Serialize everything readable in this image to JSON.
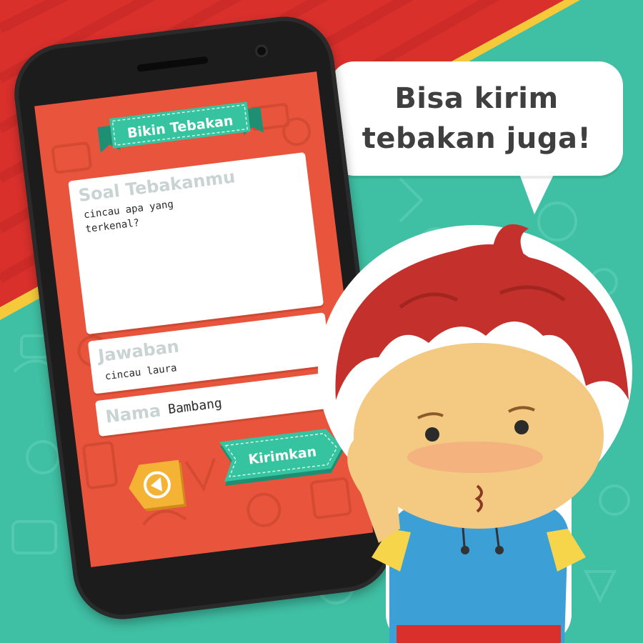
{
  "promo": {
    "speech_bubble_text": "Bisa kirim tebakan juga!"
  },
  "app_screen": {
    "title": "Bikin Tebakan",
    "question_card": {
      "label": "Soal Tebakanmu",
      "value": "cincau apa yang\nterkenal?"
    },
    "answer_card": {
      "label": "Jawaban",
      "value": "cincau laura"
    },
    "name_card": {
      "label": "Nama",
      "value": "Bambang"
    },
    "back_button_icon": "left-arrow-icon",
    "send_button_label": "Kirimkan"
  },
  "colors": {
    "background_teal": "#3fbfa3",
    "background_red": "#d9302c",
    "stripe_yellow": "#f6c93a",
    "screen_red": "#e8553c",
    "ribbon_teal": "#35c49f",
    "button_yellow": "#f5b335",
    "hair_red": "#c4302b",
    "shirt_blue": "#3c9fd6"
  }
}
